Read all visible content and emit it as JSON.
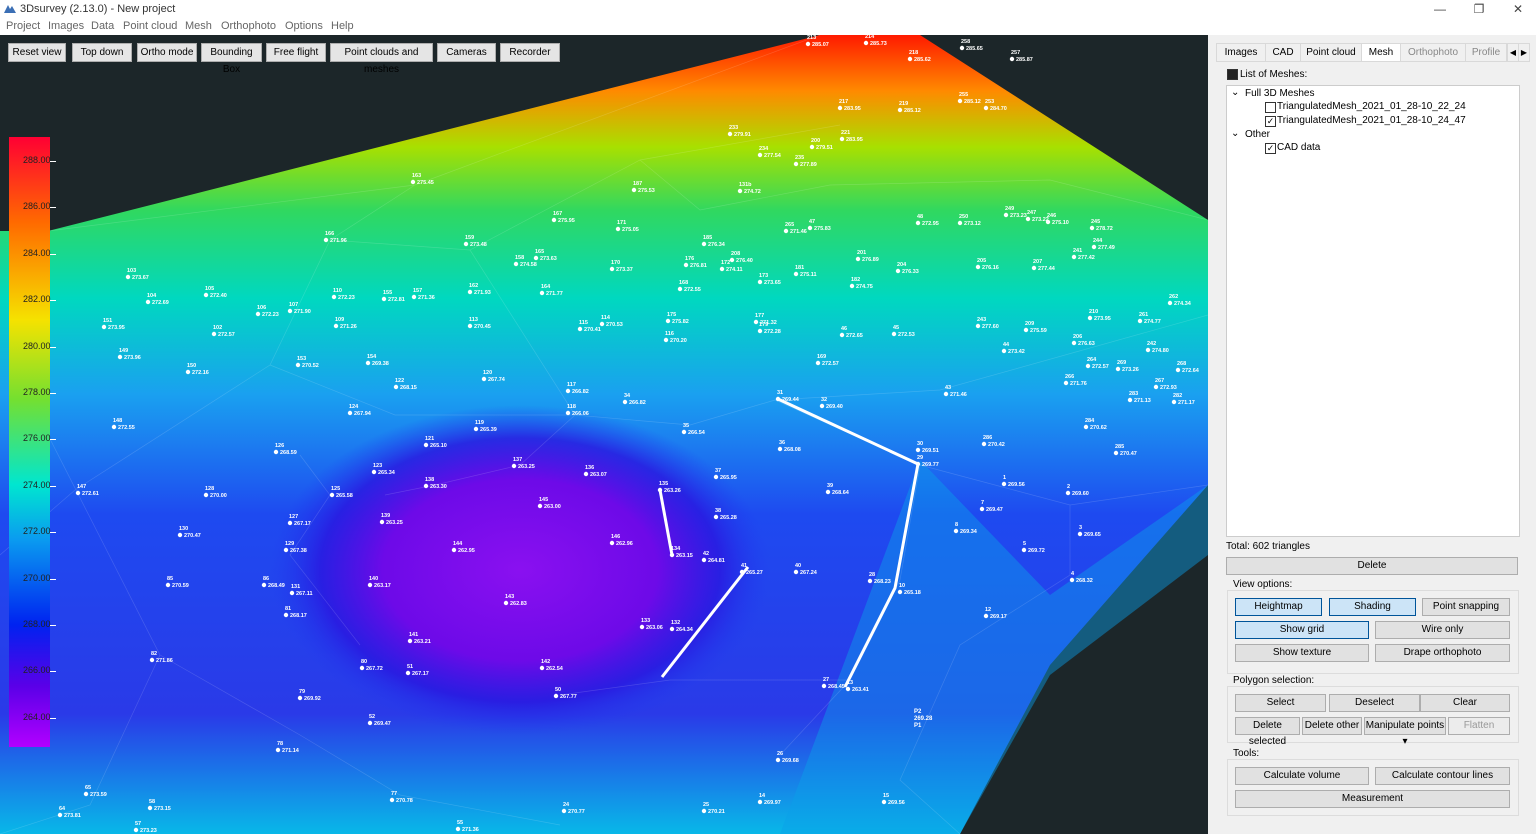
{
  "window": {
    "title": "3Dsurvey (2.13.0) - New project",
    "minimize": "—",
    "maximize": "❐",
    "close": "✕"
  },
  "menu": [
    "Project",
    "Images",
    "Data",
    "Point cloud",
    "Mesh",
    "Orthophoto",
    "Options",
    "Help"
  ],
  "toolbar": [
    "Reset view",
    "Top down",
    "Ortho mode",
    "Bounding Box",
    "Free flight",
    "Point clouds and meshes",
    "Cameras",
    "Recorder"
  ],
  "legend": {
    "labels": [
      "288.00",
      "286.00",
      "284.00",
      "282.00",
      "280.00",
      "278.00",
      "276.00",
      "274.00",
      "272.00",
      "270.00",
      "268.00",
      "266.00",
      "264.00"
    ]
  },
  "scene": {
    "points": [
      {
        "id": "213",
        "v": "285.07"
      },
      {
        "id": "214",
        "v": "285.73"
      },
      {
        "id": "218",
        "v": "285.62"
      },
      {
        "id": "258",
        "v": "285.65"
      },
      {
        "id": "257",
        "v": "285.87"
      },
      {
        "id": "163",
        "v": "275.45"
      },
      {
        "id": "166",
        "v": "271.96"
      },
      {
        "id": "103",
        "v": "273.67"
      },
      {
        "id": "104",
        "v": "272.69"
      },
      {
        "id": "105",
        "v": "272.40"
      },
      {
        "id": "151",
        "v": "273.95"
      },
      {
        "id": "149",
        "v": "273.96"
      },
      {
        "id": "150",
        "v": "272.16"
      },
      {
        "id": "148",
        "v": "272.55"
      },
      {
        "id": "147",
        "v": "272.61"
      },
      {
        "id": "128",
        "v": "270.00"
      },
      {
        "id": "130",
        "v": "270.47"
      },
      {
        "id": "85",
        "v": "270.59"
      },
      {
        "id": "82",
        "v": "271.86"
      },
      {
        "id": "86",
        "v": "268.49"
      },
      {
        "id": "131",
        "v": "267.11"
      },
      {
        "id": "81",
        "v": "268.17"
      },
      {
        "id": "129",
        "v": "267.38"
      },
      {
        "id": "127",
        "v": "267.17"
      },
      {
        "id": "126",
        "v": "268.59"
      },
      {
        "id": "125",
        "v": "265.58"
      },
      {
        "id": "123",
        "v": "265.34"
      },
      {
        "id": "121",
        "v": "265.10"
      },
      {
        "id": "124",
        "v": "267.94"
      },
      {
        "id": "122",
        "v": "268.15"
      },
      {
        "id": "120",
        "v": "267.74"
      },
      {
        "id": "119",
        "v": "265.39"
      },
      {
        "id": "117",
        "v": "266.82"
      },
      {
        "id": "118",
        "v": "266.06"
      },
      {
        "id": "34",
        "v": "266.82"
      },
      {
        "id": "35",
        "v": "266.54"
      },
      {
        "id": "36",
        "v": "268.08"
      },
      {
        "id": "37",
        "v": "265.95"
      },
      {
        "id": "38",
        "v": "265.28"
      },
      {
        "id": "39",
        "v": "268.64"
      },
      {
        "id": "137",
        "v": "263.25"
      },
      {
        "id": "136",
        "v": "263.07"
      },
      {
        "id": "135",
        "v": "263.26"
      },
      {
        "id": "138",
        "v": "263.30"
      },
      {
        "id": "145",
        "v": "263.00"
      },
      {
        "id": "139",
        "v": "263.25"
      },
      {
        "id": "144",
        "v": "262.95"
      },
      {
        "id": "146",
        "v": "262.96"
      },
      {
        "id": "134",
        "v": "263.15"
      },
      {
        "id": "42",
        "v": "264.81"
      },
      {
        "id": "41",
        "v": "265.27"
      },
      {
        "id": "40",
        "v": "267.24"
      },
      {
        "id": "143",
        "v": "262.83"
      },
      {
        "id": "140",
        "v": "263.17"
      },
      {
        "id": "141",
        "v": "263.21"
      },
      {
        "id": "133",
        "v": "263.06"
      },
      {
        "id": "132",
        "v": "264.34"
      },
      {
        "id": "142",
        "v": "262.54"
      },
      {
        "id": "80",
        "v": "267.72"
      },
      {
        "id": "51",
        "v": "267.17"
      },
      {
        "id": "50",
        "v": "267.77"
      },
      {
        "id": "79",
        "v": "269.92"
      },
      {
        "id": "52",
        "v": "269.47"
      },
      {
        "id": "78",
        "v": "271.14"
      },
      {
        "id": "77",
        "v": "270.78"
      },
      {
        "id": "65",
        "v": "273.59"
      },
      {
        "id": "64",
        "v": "273.81"
      },
      {
        "id": "58",
        "v": "273.15"
      },
      {
        "id": "57",
        "v": "273.23"
      },
      {
        "id": "55",
        "v": "271.36"
      },
      {
        "id": "24",
        "v": "270.77"
      },
      {
        "id": "25",
        "v": "270.21"
      },
      {
        "id": "14",
        "v": "269.97"
      },
      {
        "id": "15",
        "v": "269.56"
      },
      {
        "id": "26",
        "v": "269.68"
      },
      {
        "id": "27",
        "v": "268.45"
      },
      {
        "id": "13",
        "v": "263.41"
      },
      {
        "id": "28",
        "v": "268.23"
      },
      {
        "id": "10",
        "v": "265.18"
      },
      {
        "id": "12",
        "v": "269.17"
      },
      {
        "id": "31",
        "v": "269.44"
      },
      {
        "id": "32",
        "v": "269.40"
      },
      {
        "id": "30",
        "v": "269.51"
      },
      {
        "id": "29",
        "v": "269.77"
      },
      {
        "id": "43",
        "v": "271.46"
      },
      {
        "id": "286",
        "v": "270.42"
      },
      {
        "id": "1",
        "v": "269.56"
      },
      {
        "id": "2",
        "v": "269.60"
      },
      {
        "id": "7",
        "v": "269.47"
      },
      {
        "id": "8",
        "v": "269.34"
      },
      {
        "id": "3",
        "v": "269.65"
      },
      {
        "id": "5",
        "v": "269.72"
      },
      {
        "id": "4",
        "v": "268.32"
      },
      {
        "id": "285",
        "v": "270.47"
      },
      {
        "id": "284",
        "v": "270.62"
      },
      {
        "id": "283",
        "v": "271.13"
      },
      {
        "id": "282",
        "v": "271.17"
      },
      {
        "id": "44",
        "v": "273.42"
      },
      {
        "id": "45",
        "v": "272.53"
      },
      {
        "id": "46",
        "v": "272.65"
      },
      {
        "id": "177",
        "v": "271.32"
      },
      {
        "id": "116",
        "v": "270.20"
      },
      {
        "id": "115",
        "v": "270.41"
      },
      {
        "id": "114",
        "v": "270.53"
      },
      {
        "id": "113",
        "v": "270.45"
      },
      {
        "id": "153",
        "v": "270.52"
      },
      {
        "id": "154",
        "v": "269.38"
      },
      {
        "id": "109",
        "v": "271.26"
      },
      {
        "id": "102",
        "v": "272.57"
      },
      {
        "id": "106",
        "v": "272.23"
      },
      {
        "id": "107",
        "v": "271.90"
      },
      {
        "id": "110",
        "v": "272.23"
      },
      {
        "id": "155",
        "v": "272.81"
      },
      {
        "id": "157",
        "v": "271.36"
      },
      {
        "id": "162",
        "v": "271.93"
      },
      {
        "id": "164",
        "v": "271.77"
      },
      {
        "id": "158",
        "v": "274.58"
      },
      {
        "id": "159",
        "v": "273.48"
      },
      {
        "id": "165",
        "v": "273.63"
      },
      {
        "id": "167",
        "v": "275.95"
      },
      {
        "id": "171",
        "v": "275.05"
      },
      {
        "id": "170",
        "v": "273.37"
      },
      {
        "id": "168",
        "v": "272.55"
      },
      {
        "id": "172",
        "v": "274.11"
      },
      {
        "id": "173",
        "v": "273.65"
      },
      {
        "id": "181",
        "v": "275.11"
      },
      {
        "id": "182",
        "v": "274.75"
      },
      {
        "id": "47",
        "v": "275.83"
      },
      {
        "id": "201",
        "v": "276.89"
      },
      {
        "id": "204",
        "v": "276.33"
      },
      {
        "id": "205",
        "v": "276.16"
      },
      {
        "id": "207",
        "v": "277.44"
      },
      {
        "id": "241",
        "v": "277.42"
      },
      {
        "id": "244",
        "v": "277.49"
      },
      {
        "id": "243",
        "v": "277.60"
      },
      {
        "id": "209",
        "v": "275.59"
      },
      {
        "id": "206",
        "v": "276.63"
      },
      {
        "id": "210",
        "v": "273.95"
      },
      {
        "id": "261",
        "v": "274.77"
      },
      {
        "id": "262",
        "v": "274.34"
      },
      {
        "id": "242",
        "v": "274.80"
      },
      {
        "id": "264",
        "v": "272.57"
      },
      {
        "id": "269",
        "v": "273.26"
      },
      {
        "id": "268",
        "v": "272.64"
      },
      {
        "id": "266",
        "v": "271.76"
      },
      {
        "id": "267",
        "v": "272.93"
      },
      {
        "id": "265",
        "v": "271.46"
      },
      {
        "id": "208",
        "v": "276.40"
      },
      {
        "id": "185",
        "v": "276.34"
      },
      {
        "id": "176",
        "v": "276.81"
      },
      {
        "id": "175",
        "v": "275.82"
      },
      {
        "id": "169",
        "v": "272.57"
      },
      {
        "id": "179",
        "v": "272.28"
      },
      {
        "id": "48",
        "v": "272.95"
      },
      {
        "id": "250",
        "v": "273.12"
      },
      {
        "id": "249",
        "v": "273.23"
      },
      {
        "id": "246",
        "v": "275.10"
      },
      {
        "id": "245",
        "v": "278.72"
      },
      {
        "id": "247",
        "v": "273.22"
      },
      {
        "id": "253",
        "v": "284.70"
      },
      {
        "id": "255",
        "v": "285.12"
      },
      {
        "id": "219",
        "v": "285.12"
      },
      {
        "id": "217",
        "v": "283.95"
      },
      {
        "id": "221",
        "v": "283.95"
      },
      {
        "id": "233",
        "v": "279.91"
      },
      {
        "id": "234",
        "v": "277.54"
      },
      {
        "id": "235",
        "v": "277.89"
      },
      {
        "id": "200",
        "v": "279.51"
      },
      {
        "id": "131b",
        "v": "274.72"
      },
      {
        "id": "187",
        "v": "275.53"
      }
    ],
    "extra_labels": [
      "P2",
      "269.28",
      "P1"
    ]
  },
  "panel": {
    "tabs": [
      "Images",
      "CAD",
      "Point cloud",
      "Mesh",
      "Orthophoto",
      "Profile"
    ],
    "scroll_left": "◀",
    "scroll_right": "▶",
    "list_title": "List of Meshes:",
    "tree": {
      "group1": "Full 3D Meshes",
      "mesh1": "TriangulatedMesh_2021_01_28-10_22_24",
      "mesh2": "TriangulatedMesh_2021_01_28-10_24_47",
      "group2": "Other",
      "cad": "CAD data",
      "expander": "⌄"
    },
    "total": "Total: 602 triangles",
    "delete": "Delete",
    "view_options": {
      "label": "View options:",
      "buttons": [
        "Heightmap",
        "Shading",
        "Point snapping",
        "Show grid",
        "Wire only",
        "Show texture",
        "Drape orthophoto"
      ]
    },
    "polygon": {
      "label": "Polygon selection:",
      "buttons": [
        "Select",
        "Deselect",
        "Clear",
        "Delete selected",
        "Delete other",
        "Manipulate points",
        "Flatten"
      ],
      "dropdown_arrow": "▾"
    },
    "tools": {
      "label": "Tools:",
      "buttons": [
        "Calculate volume",
        "Calculate contour lines",
        "Measurement"
      ]
    }
  },
  "colors": {
    "viewport_bg": "#1c2629",
    "selection_on": "#cce4f7",
    "selection_border": "#005499"
  }
}
